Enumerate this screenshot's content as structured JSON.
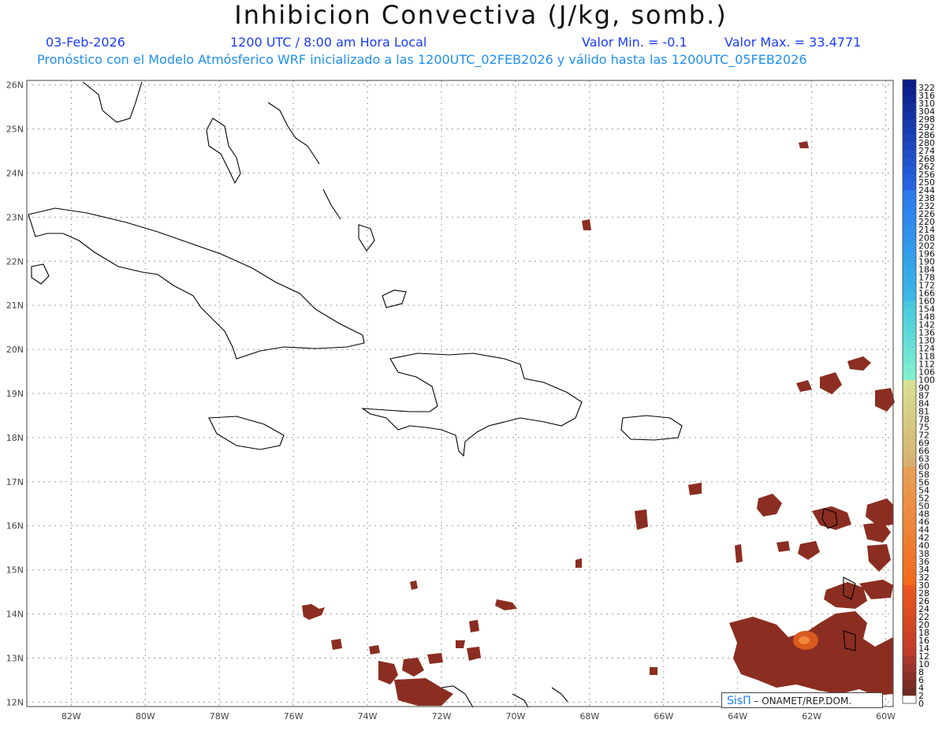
{
  "header": {
    "title": "Inhibicion Convectiva (J/kg, somb.)",
    "date": "03-Feb-2026",
    "time": "1200 UTC / 8:00 am Hora Local",
    "valor_min": "Valor Min. = -0.1",
    "valor_max": "Valor Max. = 33.4771",
    "description": "Pronóstico con el Modelo Atmósferico WRF inicializado a las 1200UTC_02FEB2026 y válido hasta las  1200UTC_05FEB2026"
  },
  "map": {
    "lon_range": [
      -83.2,
      -59.8
    ],
    "lat_range": [
      11.9,
      26.1
    ],
    "lon_ticks": [
      "82W",
      "80W",
      "78W",
      "76W",
      "74W",
      "72W",
      "70W",
      "68W",
      "66W",
      "64W",
      "62W",
      "60W"
    ],
    "lat_ticks": [
      "12N",
      "13N",
      "14N",
      "15N",
      "16N",
      "17N",
      "18N",
      "19N",
      "20N",
      "21N",
      "22N",
      "23N",
      "24N",
      "25N",
      "26N"
    ],
    "gridlines": true,
    "coastline_color": "#000000",
    "field_color": "#8b2e21",
    "field_highlight_color": "#d85a1e"
  },
  "colorbar": {
    "labels": [
      "0",
      "2",
      "4",
      "6",
      "8",
      "10",
      "12",
      "14",
      "16",
      "18",
      "20",
      "22",
      "24",
      "26",
      "28",
      "30",
      "32",
      "34",
      "36",
      "38",
      "40",
      "42",
      "44",
      "46",
      "48",
      "50",
      "52",
      "54",
      "56",
      "58",
      "60",
      "63",
      "66",
      "69",
      "72",
      "75",
      "78",
      "81",
      "84",
      "87",
      "90",
      "100",
      "106",
      "112",
      "118",
      "124",
      "130",
      "136",
      "142",
      "148",
      "154",
      "160",
      "166",
      "172",
      "178",
      "184",
      "190",
      "196",
      "202",
      "208",
      "214",
      "220",
      "226",
      "232",
      "238",
      "244",
      "250",
      "256",
      "262",
      "268",
      "274",
      "280",
      "286",
      "292",
      "298",
      "304",
      "310",
      "316",
      "322"
    ]
  },
  "credit": {
    "brand": "SisΠ",
    "text": " – ONAMET/REP.DOM."
  }
}
